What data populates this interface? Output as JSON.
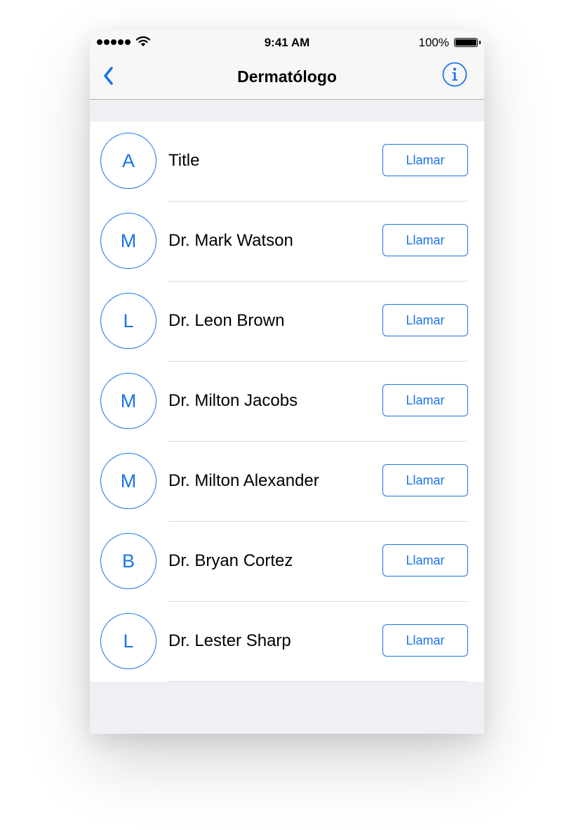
{
  "status_bar": {
    "time": "9:41 AM",
    "battery_percent": "100%",
    "signal_bars": 5,
    "icons": [
      "signal-dots-icon",
      "wifi-icon",
      "battery-icon"
    ]
  },
  "nav_bar": {
    "title": "Dermatólogo",
    "back_icon": "chevron-left-icon",
    "info_icon": "info-icon"
  },
  "colors": {
    "accent": "#1a73e8",
    "background": "#efeff4",
    "bar_background": "#f7f7f7"
  },
  "contacts": [
    {
      "initial": "A",
      "name": "Title",
      "call_label": "Llamar"
    },
    {
      "initial": "M",
      "name": "Dr. Mark Watson",
      "call_label": "Llamar"
    },
    {
      "initial": "L",
      "name": "Dr. Leon Brown",
      "call_label": "Llamar"
    },
    {
      "initial": "M",
      "name": "Dr. Milton Jacobs",
      "call_label": "Llamar"
    },
    {
      "initial": "M",
      "name": "Dr. Milton Alexander",
      "call_label": "Llamar"
    },
    {
      "initial": "B",
      "name": "Dr. Bryan Cortez",
      "call_label": "Llamar"
    },
    {
      "initial": "L",
      "name": "Dr. Lester Sharp",
      "call_label": "Llamar"
    }
  ]
}
